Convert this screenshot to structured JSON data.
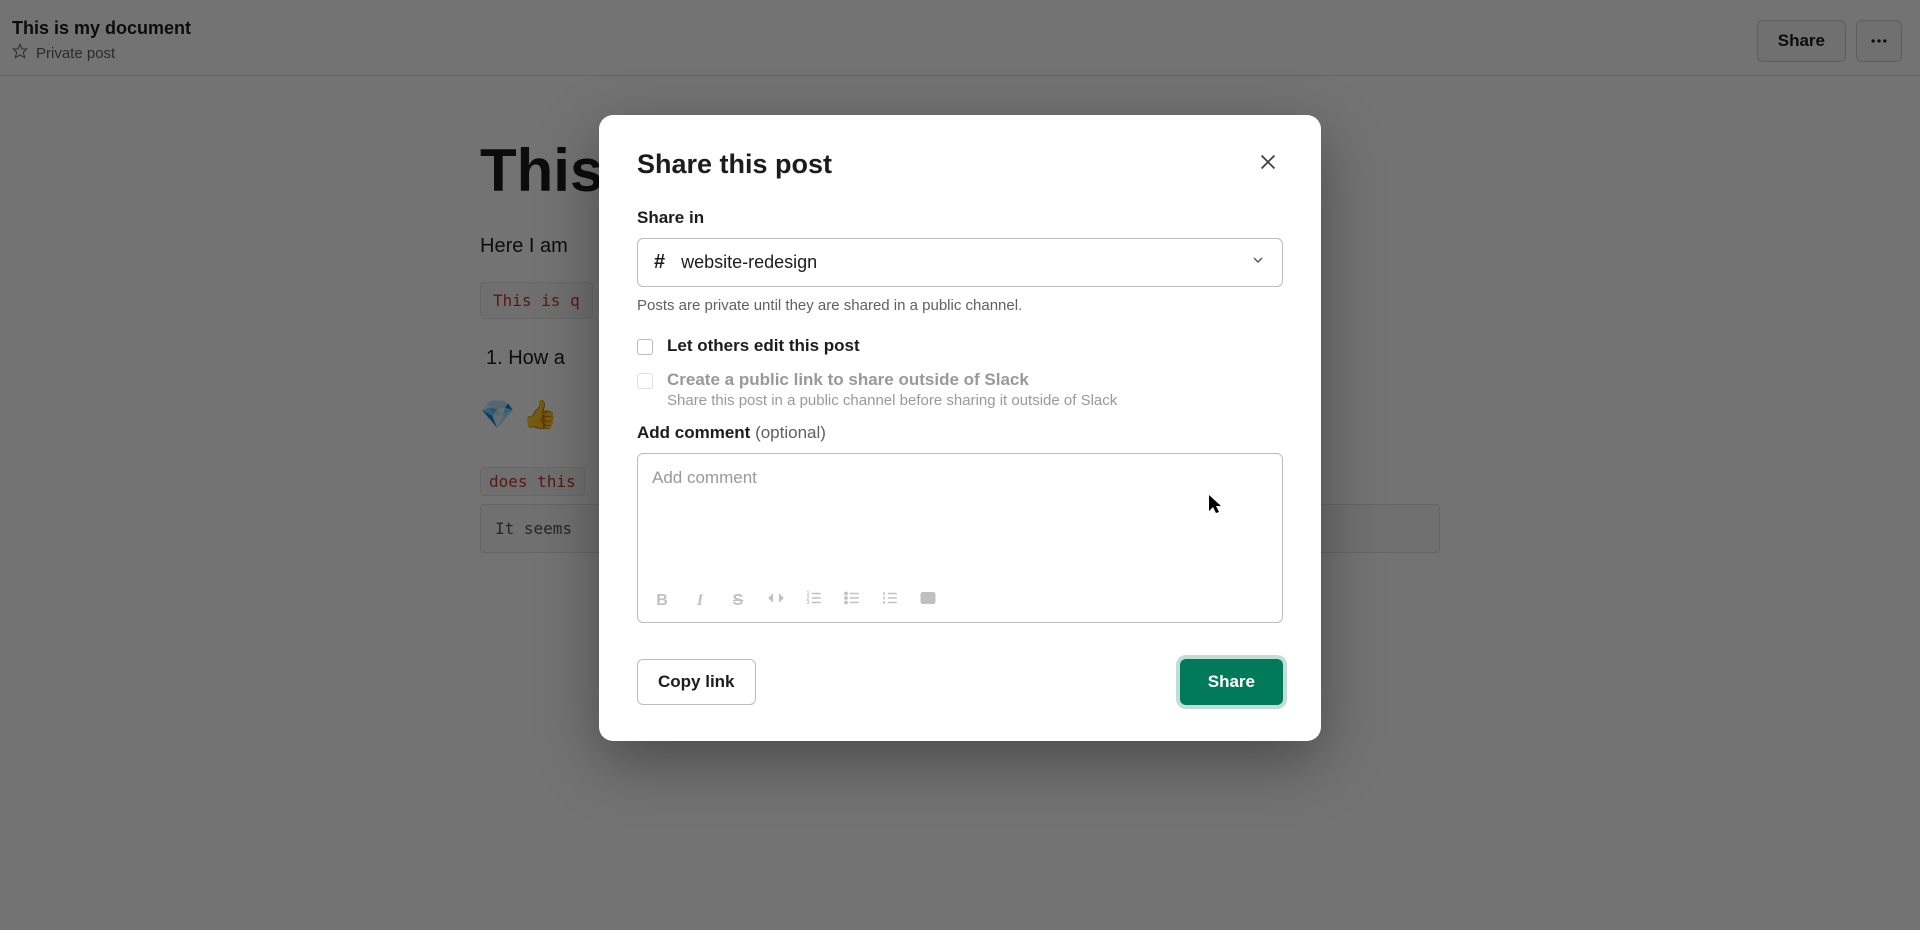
{
  "header": {
    "title": "This is my document",
    "meta": "Private post",
    "share_label": "Share"
  },
  "doc": {
    "heading_partial": "This",
    "paragraph_partial": "Here I am",
    "code_partial": "This is q",
    "list_partial": "1.  How a",
    "emoji": "💎 👍",
    "inline_code_partial": "does this",
    "block_partial": "It seems"
  },
  "modal": {
    "title": "Share this post",
    "share_in_label": "Share in",
    "channel": "website-redesign",
    "help_text": "Posts are private until they are shared in a public channel.",
    "checkbox_edit": "Let others edit this post",
    "checkbox_public": "Create a public link to share outside of Slack",
    "checkbox_public_sub": "Share this post in a public channel before sharing it outside of Slack",
    "add_comment_label": "Add comment",
    "add_comment_optional": " (optional)",
    "comment_placeholder": "Add comment",
    "copy_link_label": "Copy link",
    "share_label": "Share"
  }
}
